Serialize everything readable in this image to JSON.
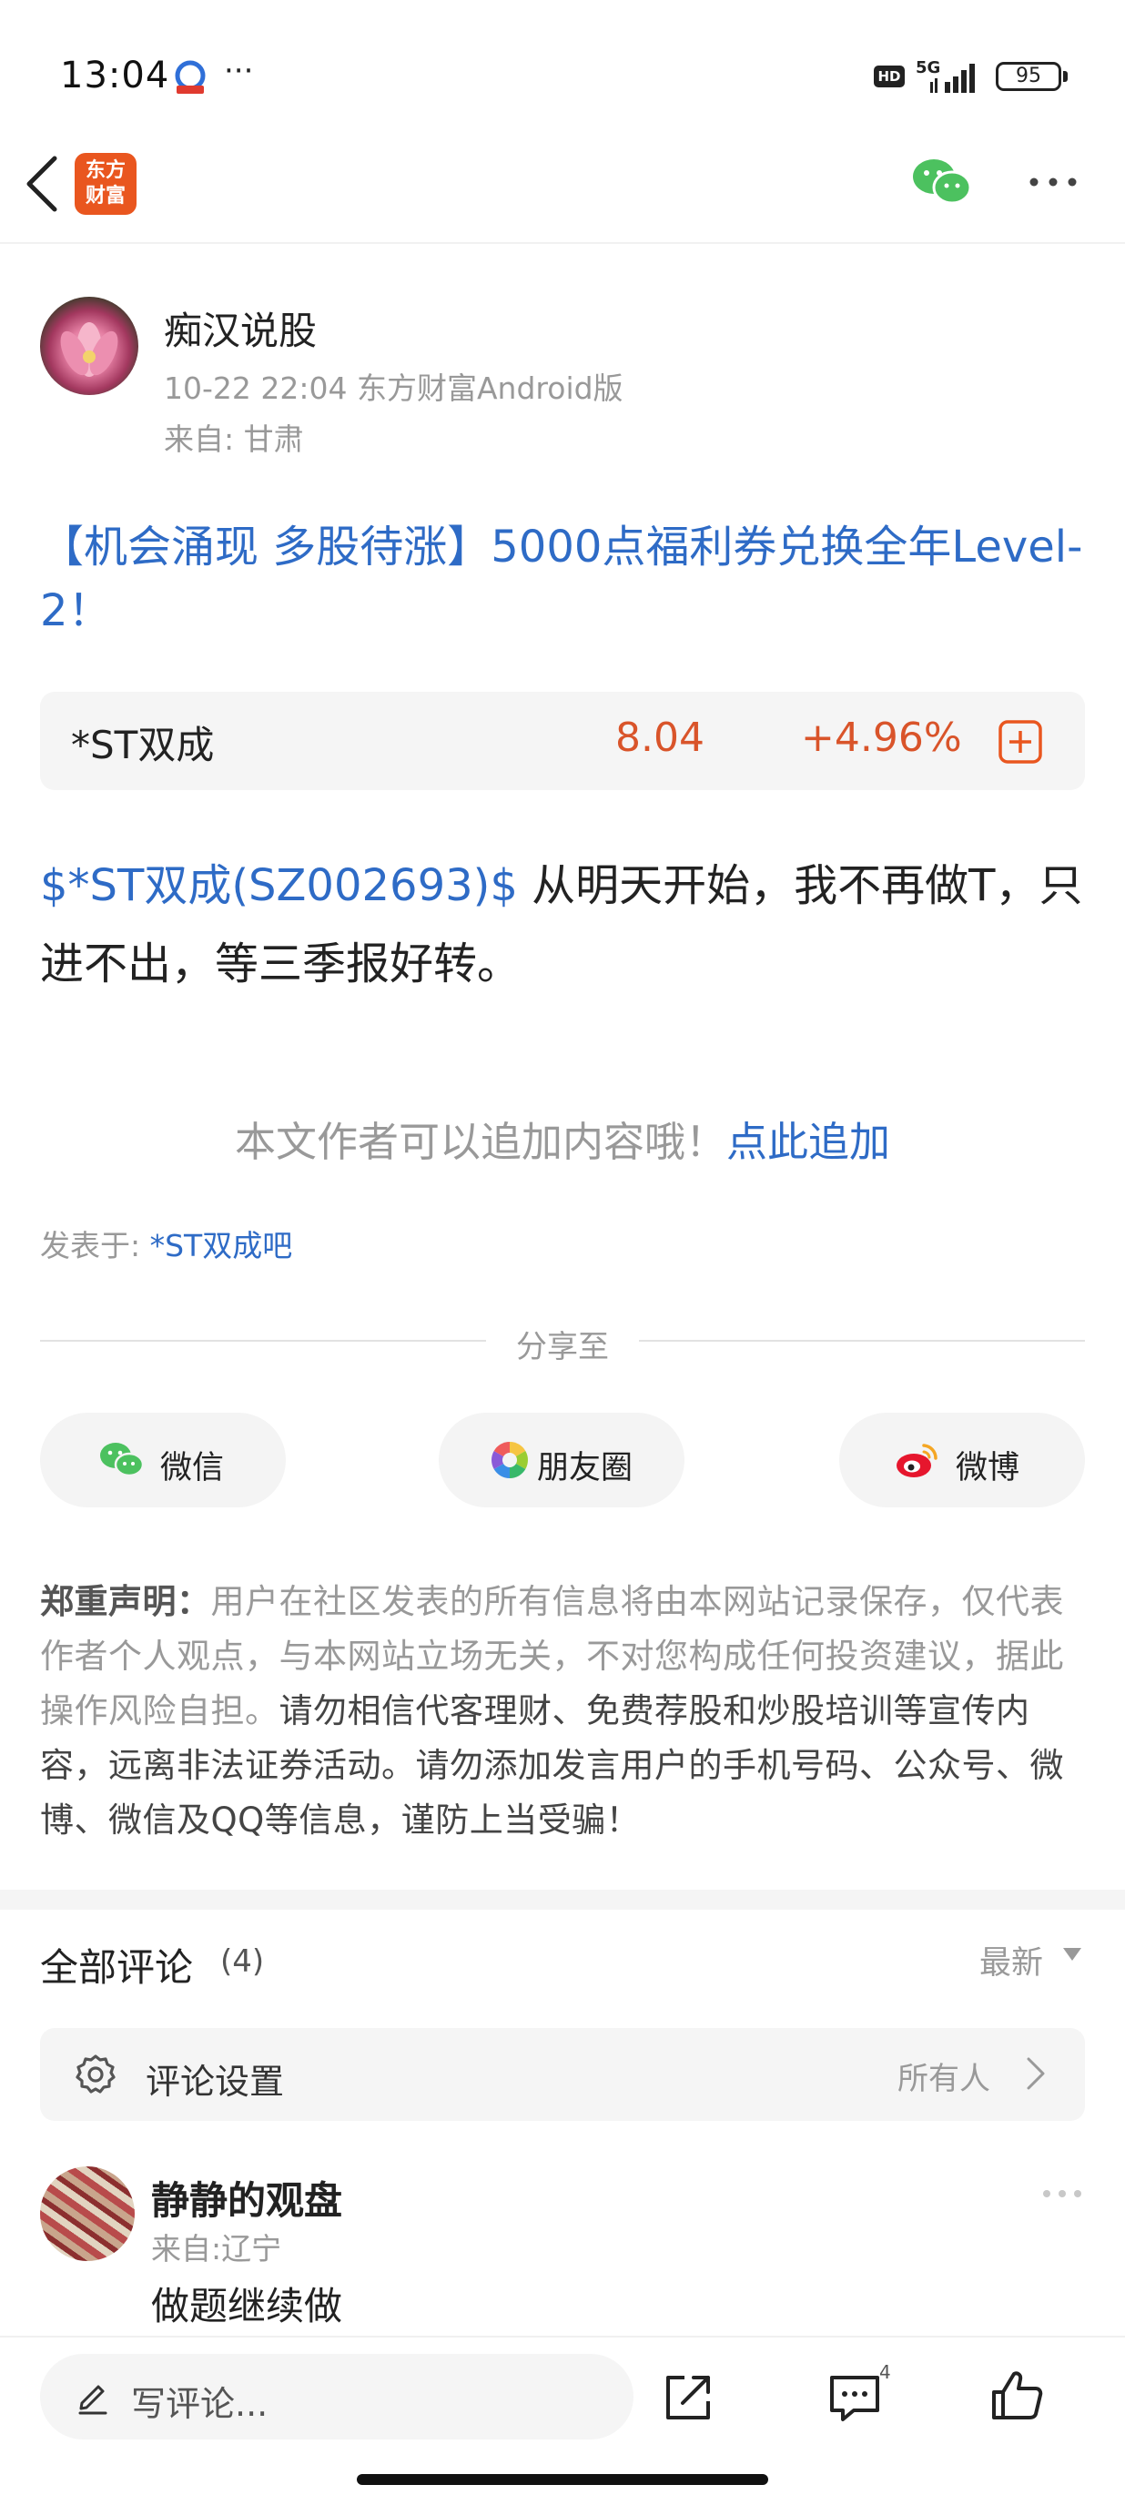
{
  "status_bar": {
    "time": "13:04",
    "more": "···",
    "hd_badge": "HD",
    "network": "5G",
    "battery": "95"
  },
  "nav": {
    "logo_text_line1": "东方",
    "logo_text_line2": "财富",
    "icons": [
      "back-chevron-icon",
      "wechat-icon",
      "more-icon"
    ]
  },
  "author": {
    "name": "痴汉说股",
    "meta": "10-22 22:04 东方财富Android版",
    "from": "来自: 甘肃"
  },
  "post": {
    "title": "【机会涌现 多股待涨】5000点福利券兑换全年Level-2！",
    "stock_link": "$*ST双成(SZ002693)$",
    "body": " 从明天开始，我不再做T，只进不出，等三季报好转。",
    "append_prompt": "本文作者可以追加内容哦！",
    "append_link": "点此追加",
    "posted_in_label": "发表于: ",
    "posted_in_bar": "*ST双成吧"
  },
  "stock_card": {
    "name": "*ST双成",
    "price": "8.04",
    "change": "+4.96%",
    "accent": "#d9542a"
  },
  "share": {
    "label": "分享至",
    "buttons": [
      {
        "label": "微信",
        "icon": "wechat-icon"
      },
      {
        "label": "朋友圈",
        "icon": "moments-icon"
      },
      {
        "label": "微博",
        "icon": "weibo-icon"
      }
    ]
  },
  "disclaimer": {
    "heading": "郑重声明：",
    "text_normal": "用户在社区发表的所有信息将由本网站记录保存，仅代表作者个人观点，与本网站立场无关，不对您构成任何投资建议，据此操作风险自担。",
    "text_dark": "请勿相信代客理财、免费荐股和炒股培训等宣传内容，远离非法证券活动。请勿添加发言用户的手机号码、公众号、微博、微信及QQ等信息，谨防上当受骗！"
  },
  "comments": {
    "title": "全部评论",
    "count": "(4)",
    "sort": "最新",
    "settings_label": "评论设置",
    "settings_value": "所有人",
    "items": [
      {
        "name": "静静的观盘",
        "from": "来自:辽宁",
        "body": "做题继续做"
      }
    ]
  },
  "bottom_bar": {
    "placeholder": "写评论...",
    "comment_count": "4"
  },
  "colors": {
    "link_blue": "#2e6bc6",
    "brand_orange": "#e9561f",
    "up_red": "#d9542a"
  }
}
